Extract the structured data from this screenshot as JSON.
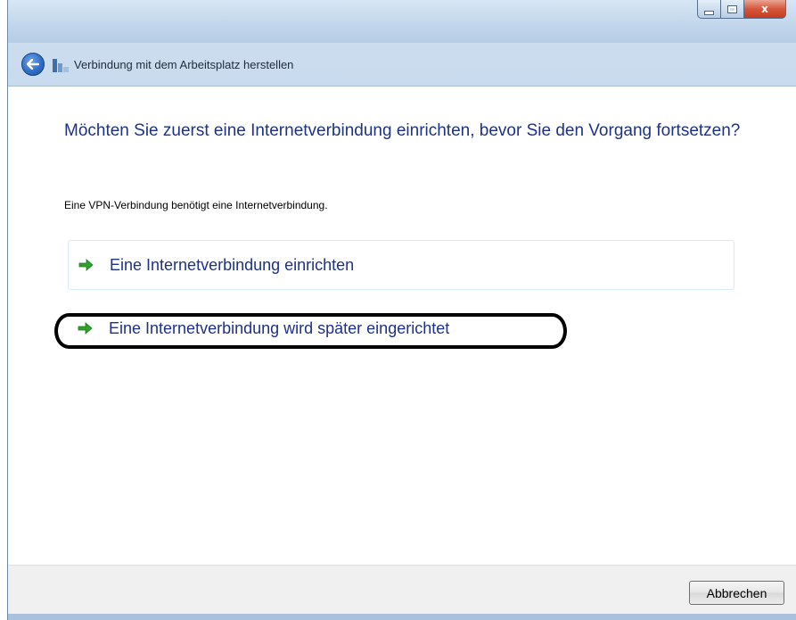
{
  "window": {
    "title": "Verbindung mit dem Arbeitsplatz herstellen",
    "close_glyph": "x"
  },
  "main": {
    "heading": "Möchten Sie zuerst eine Internetverbindung einrichten, bevor Sie den Vorgang fortsetzen?",
    "description": "Eine VPN-Verbindung benötigt eine Internetverbindung.",
    "options": [
      {
        "label": "Eine Internetverbindung einrichten",
        "icon": "green-arrow-icon"
      },
      {
        "label": "Eine Internetverbindung wird später eingerichtet",
        "icon": "green-arrow-icon"
      }
    ]
  },
  "footer": {
    "cancel_label": "Abbrechen"
  },
  "colors": {
    "heading": "#1e3287",
    "arrow": "#2fa12f",
    "annotation": "#000000"
  }
}
